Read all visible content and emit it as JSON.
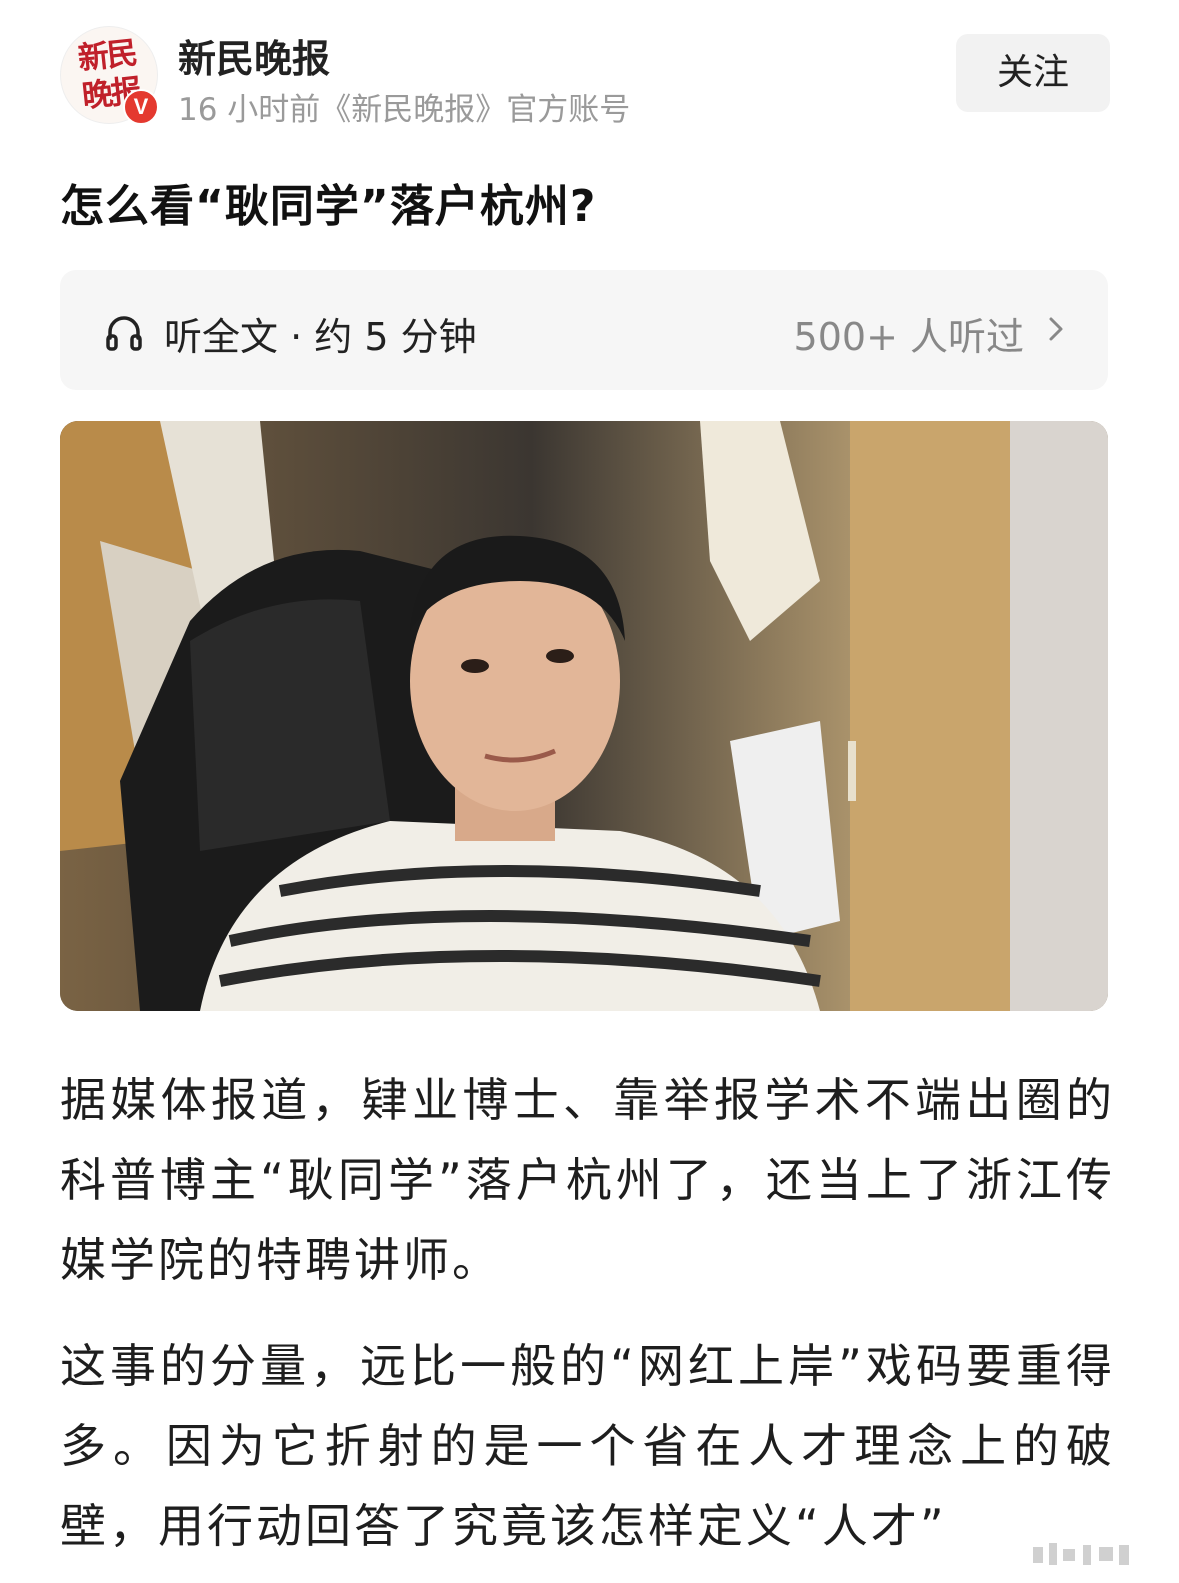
{
  "account": {
    "name": "新民晚报",
    "meta": "16 小时前《新民晚报》官方账号",
    "avatar_text_line1": "新民",
    "avatar_text_line2": "晚报",
    "verified_badge": "V",
    "follow_label": "关注"
  },
  "article": {
    "title": "怎么看“耿同学”落户杭州?",
    "paragraph1": "据媒体报道，肄业博士、靠举报学术不端出圈的科普博主“耿同学”落户杭州了，还当上了浙江传媒学院的特聘讲师。",
    "paragraph2": "这事的分量，远比一般的“网红上岸”戏码要重得多。因为它折射的是一个省在人才理念上的破壁，用行动回答了究竟该怎样定义“人才”"
  },
  "listen": {
    "icon": "headphones-icon",
    "label": "听全文 · 约 5 分钟",
    "count": "500+ 人听过",
    "chevron_icon": "chevron-right-icon"
  },
  "photo": {
    "description_icon": "article-photo"
  },
  "colors": {
    "accent_red": "#e4392f",
    "muted_text": "#9a9a9a",
    "bar_bg": "#f6f6f6"
  }
}
